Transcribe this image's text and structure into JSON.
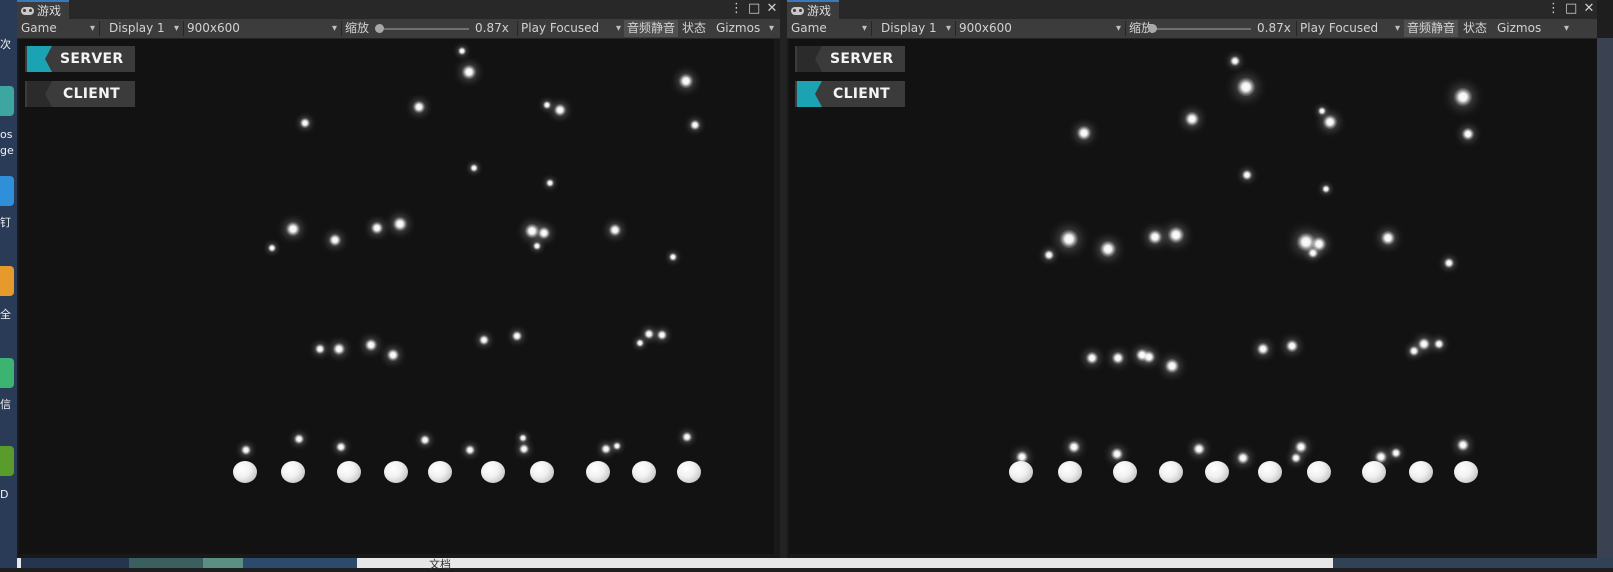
{
  "desktop": {
    "left_labels": [
      "次",
      "os",
      "ge",
      "钉",
      "全",
      "信",
      "D"
    ],
    "bottom_labels": [
      "文档"
    ]
  },
  "panes": [
    {
      "id": "left",
      "tab_title": "游戏",
      "toolbar": {
        "view": "Game",
        "display": "Display 1",
        "resolution": "900x600",
        "scale_label": "缩放",
        "scale_value": "0.87x",
        "play_mode": "Play Focused",
        "mute_audio": "音频静音",
        "stats": "状态",
        "gizmos": "Gizmos"
      },
      "hud": {
        "server_label": "SERVER",
        "client_label": "CLIENT",
        "active": "server"
      }
    },
    {
      "id": "right",
      "tab_title": "游戏",
      "toolbar": {
        "view": "Game",
        "display": "Display 1",
        "resolution": "900x600",
        "scale_label": "缩放",
        "scale_value": "0.87x",
        "play_mode": "Play Focused",
        "mute_audio": "音频静音",
        "stats": "状态",
        "gizmos": "Gizmos"
      },
      "hud": {
        "server_label": "SERVER",
        "client_label": "CLIENT",
        "active": "client"
      }
    }
  ],
  "colors": {
    "accent": "#1ba3b4",
    "viewport_bg": "#121212",
    "toolbar_bg": "#3c3c3c",
    "tab_highlight": "#3a79bb"
  },
  "icons": [
    "game-controller-icon",
    "more-icon",
    "maximize-icon",
    "close-icon",
    "dropdown-arrow-icon",
    "flag-icon"
  ]
}
